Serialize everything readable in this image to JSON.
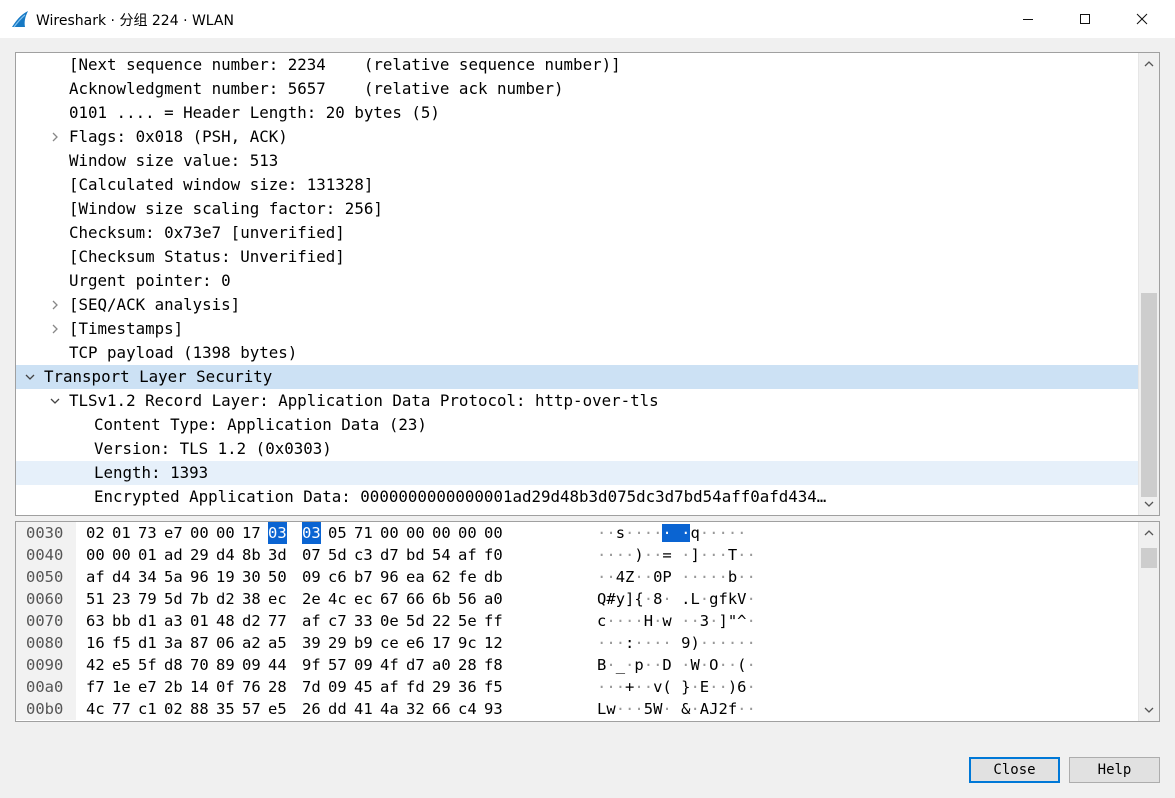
{
  "window": {
    "title": "Wireshark · 分组 224 · WLAN",
    "app_icon": "wireshark-fin-icon",
    "controls": [
      "minimize-icon",
      "maximize-icon",
      "close-icon"
    ]
  },
  "tree": {
    "rows": [
      {
        "text": "[Next sequence number: 2234    (relative sequence number)]",
        "expander": "none"
      },
      {
        "text": "Acknowledgment number: 5657    (relative ack number)",
        "expander": "none"
      },
      {
        "text": "0101 .... = Header Length: 20 bytes (5)",
        "expander": "none"
      },
      {
        "text": "Flags: 0x018 (PSH, ACK)",
        "expander": "collapsed"
      },
      {
        "text": "Window size value: 513",
        "expander": "none"
      },
      {
        "text": "[Calculated window size: 131328]",
        "expander": "none"
      },
      {
        "text": "[Window size scaling factor: 256]",
        "expander": "none"
      },
      {
        "text": "Checksum: 0x73e7 [unverified]",
        "expander": "none"
      },
      {
        "text": "[Checksum Status: Unverified]",
        "expander": "none"
      },
      {
        "text": "Urgent pointer: 0",
        "expander": "none"
      },
      {
        "text": "[SEQ/ACK analysis]",
        "expander": "collapsed"
      },
      {
        "text": "[Timestamps]",
        "expander": "collapsed"
      },
      {
        "text": "TCP payload (1398 bytes)",
        "expander": "none"
      },
      {
        "text": "Transport Layer Security",
        "expander": "expanded",
        "state": "highlighted"
      },
      {
        "text": "TLSv1.2 Record Layer: Application Data Protocol: http-over-tls",
        "expander": "expanded"
      },
      {
        "text": "Content Type: Application Data (23)",
        "expander": "none"
      },
      {
        "text": "Version: TLS 1.2 (0x0303)",
        "expander": "none"
      },
      {
        "text": "Length: 1393",
        "expander": "none",
        "state": "selected"
      },
      {
        "text": "Encrypted Application Data: 0000000000000001ad29d48b3d075dc3d7bd54aff0afd434…",
        "expander": "none"
      }
    ]
  },
  "hex": {
    "rows": [
      {
        "offset": "0030",
        "bytes": [
          "02",
          "01",
          "73",
          "e7",
          "00",
          "00",
          "17",
          "03",
          "03",
          "05",
          "71",
          "00",
          "00",
          "00",
          "00",
          "00"
        ],
        "ascii": "··s····· ·q·····",
        "hl_bytes": [
          7,
          8
        ],
        "hl_ascii": [
          7,
          9
        ]
      },
      {
        "offset": "0040",
        "bytes": [
          "00",
          "00",
          "01",
          "ad",
          "29",
          "d4",
          "8b",
          "3d",
          "07",
          "5d",
          "c3",
          "d7",
          "bd",
          "54",
          "af",
          "f0"
        ],
        "ascii": "····)··= ·]···T··"
      },
      {
        "offset": "0050",
        "bytes": [
          "af",
          "d4",
          "34",
          "5a",
          "96",
          "19",
          "30",
          "50",
          "09",
          "c6",
          "b7",
          "96",
          "ea",
          "62",
          "fe",
          "db"
        ],
        "ascii": "··4Z··0P ·····b··"
      },
      {
        "offset": "0060",
        "bytes": [
          "51",
          "23",
          "79",
          "5d",
          "7b",
          "d2",
          "38",
          "ec",
          "2e",
          "4c",
          "ec",
          "67",
          "66",
          "6b",
          "56",
          "a0"
        ],
        "ascii": "Q#y]{·8· .L·gfkV·"
      },
      {
        "offset": "0070",
        "bytes": [
          "63",
          "bb",
          "d1",
          "a3",
          "01",
          "48",
          "d2",
          "77",
          "af",
          "c7",
          "33",
          "0e",
          "5d",
          "22",
          "5e",
          "ff"
        ],
        "ascii": "c····H·w ··3·]\"^·"
      },
      {
        "offset": "0080",
        "bytes": [
          "16",
          "f5",
          "d1",
          "3a",
          "87",
          "06",
          "a2",
          "a5",
          "39",
          "29",
          "b9",
          "ce",
          "e6",
          "17",
          "9c",
          "12"
        ],
        "ascii": "···:···· 9)······"
      },
      {
        "offset": "0090",
        "bytes": [
          "42",
          "e5",
          "5f",
          "d8",
          "70",
          "89",
          "09",
          "44",
          "9f",
          "57",
          "09",
          "4f",
          "d7",
          "a0",
          "28",
          "f8"
        ],
        "ascii": "B·_·p··D ·W·O··(·"
      },
      {
        "offset": "00a0",
        "bytes": [
          "f7",
          "1e",
          "e7",
          "2b",
          "14",
          "0f",
          "76",
          "28",
          "7d",
          "09",
          "45",
          "af",
          "fd",
          "29",
          "36",
          "f5"
        ],
        "ascii": "···+··v( }·E··)6·"
      },
      {
        "offset": "00b0",
        "bytes": [
          "4c",
          "77",
          "c1",
          "02",
          "88",
          "35",
          "57",
          "e5",
          "26",
          "dd",
          "41",
          "4a",
          "32",
          "66",
          "c4",
          "93"
        ],
        "ascii": "Lw···5W· &·AJ2f··"
      }
    ]
  },
  "buttons": {
    "close_label": "Close",
    "help_label": "Help"
  }
}
